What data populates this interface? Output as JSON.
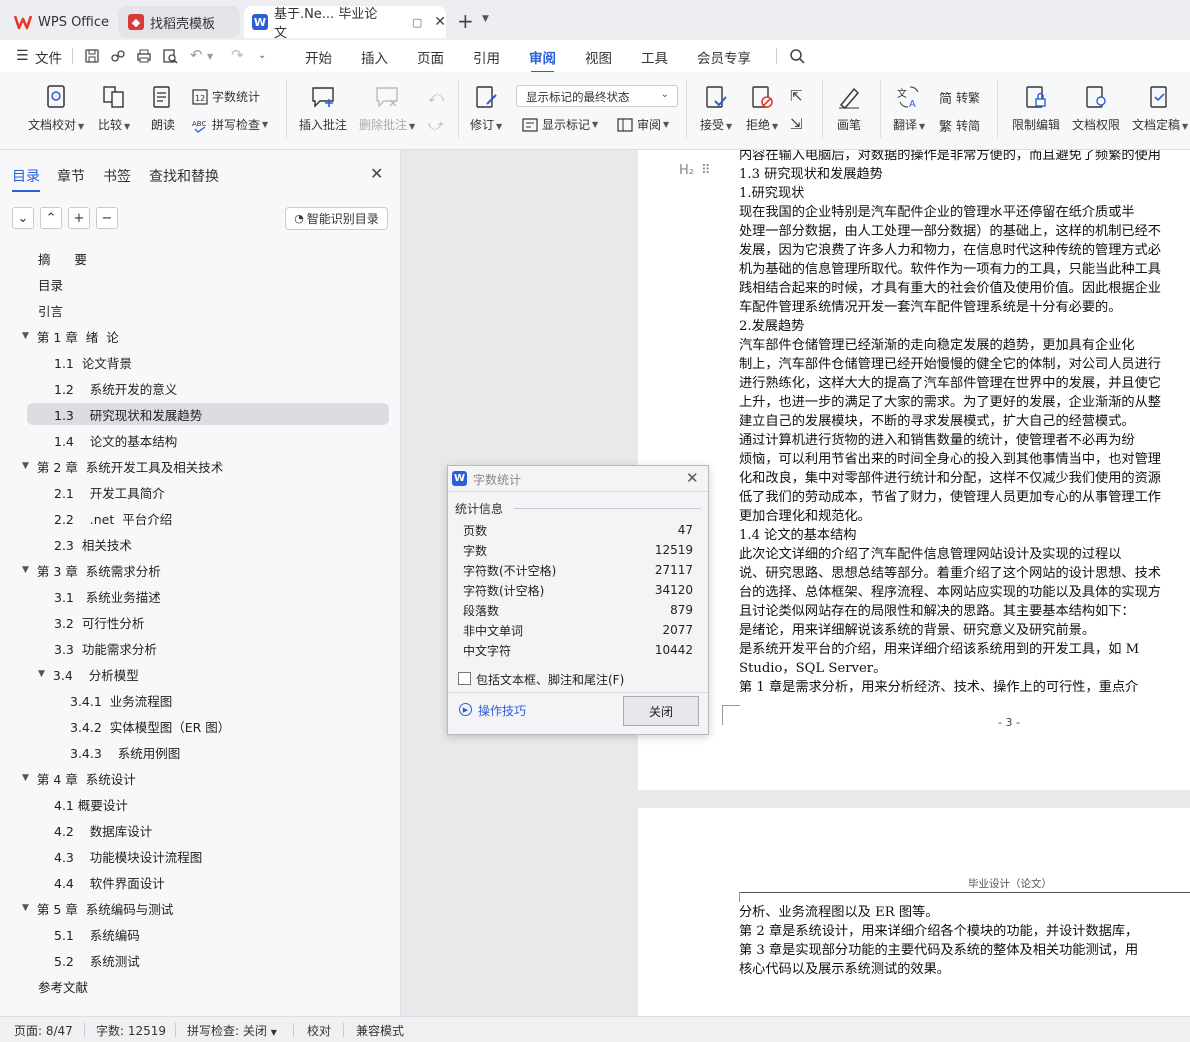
{
  "titlebar": {
    "tabs": [
      {
        "label": "WPS Office"
      },
      {
        "label": "找稻壳模板"
      },
      {
        "label": "基于.Ne... 毕业论文"
      }
    ],
    "new_tab": "+"
  },
  "menubar": {
    "file": "文件",
    "items": [
      "开始",
      "插入",
      "页面",
      "引用",
      "审阅",
      "视图",
      "工具",
      "会员专享"
    ],
    "active": "审阅"
  },
  "ribbon": {
    "doc_proof": "文档校对",
    "compare": "比较",
    "read_aloud": "朗读",
    "word_count": "字数统计",
    "spell_check": "拼写检查",
    "insert_comment": "插入批注",
    "delete_comment": "删除批注",
    "revise": "修订",
    "markup_state": "显示标记的最终状态",
    "show_markup": "显示标记",
    "review_pane": "审阅",
    "accept": "接受",
    "reject": "拒绝",
    "pen": "画笔",
    "translate": "翻译",
    "to_traditional": "转繁",
    "to_simplified": "转简",
    "restrict_edit": "限制编辑",
    "doc_permission": "文档权限",
    "doc_finalize": "文档定稿"
  },
  "nav": {
    "tabs": [
      "目录",
      "章节",
      "书签",
      "查找和替换"
    ],
    "smart_toc": "智能识别目录",
    "toc": [
      {
        "text": "摘      要",
        "level": 0,
        "tri": ""
      },
      {
        "text": "目录",
        "level": 0,
        "tri": ""
      },
      {
        "text": "引言",
        "level": 0,
        "tri": ""
      },
      {
        "text": "第 1 章  绪  论",
        "level": 0,
        "tri": "▼"
      },
      {
        "text": "1.1  论文背景",
        "level": 1,
        "tri": ""
      },
      {
        "text": "1.2    系统开发的意义",
        "level": 1,
        "tri": ""
      },
      {
        "text": "1.3    研究现状和发展趋势",
        "level": 1,
        "tri": "",
        "selected": true
      },
      {
        "text": "1.4    论文的基本结构",
        "level": 1,
        "tri": ""
      },
      {
        "text": "第 2 章  系统开发工具及相关技术",
        "level": 0,
        "tri": "▼"
      },
      {
        "text": "2.1    开发工具简介",
        "level": 1,
        "tri": ""
      },
      {
        "text": "2.2    .net  平台介绍",
        "level": 1,
        "tri": ""
      },
      {
        "text": "2.3  相关技术",
        "level": 1,
        "tri": ""
      },
      {
        "text": "第 3 章  系统需求分析",
        "level": 0,
        "tri": "▼"
      },
      {
        "text": "3.1   系统业务描述",
        "level": 1,
        "tri": ""
      },
      {
        "text": "3.2  可行性分析",
        "level": 1,
        "tri": ""
      },
      {
        "text": "3.3  功能需求分析",
        "level": 1,
        "tri": ""
      },
      {
        "text": "3.4    分析模型",
        "level": 1,
        "tri": "▼"
      },
      {
        "text": "3.4.1  业务流程图",
        "level": 2,
        "tri": ""
      },
      {
        "text": "3.4.2  实体模型图（ER 图）",
        "level": 2,
        "tri": ""
      },
      {
        "text": "3.4.3    系统用例图",
        "level": 2,
        "tri": ""
      },
      {
        "text": "第 4 章  系统设计",
        "level": 0,
        "tri": "▼"
      },
      {
        "text": "4.1 概要设计",
        "level": 1,
        "tri": ""
      },
      {
        "text": "4.2    数据库设计",
        "level": 1,
        "tri": ""
      },
      {
        "text": "4.3    功能模块设计流程图",
        "level": 1,
        "tri": ""
      },
      {
        "text": "4.4    软件界面设计",
        "level": 1,
        "tri": ""
      },
      {
        "text": "第 5 章  系统编码与测试",
        "level": 0,
        "tri": "▼"
      },
      {
        "text": "5.1    系统编码",
        "level": 1,
        "tri": ""
      },
      {
        "text": "5.2    系统测试",
        "level": 1,
        "tri": ""
      },
      {
        "text": "参考文献",
        "level": 0,
        "tri": ""
      }
    ]
  },
  "document": {
    "heading_marker": "H₂",
    "page1_lines": [
      "内容在输入电脑后，对数据的操作是非常方便的，而且避免了频繁的使用",
      "1.3    研究现状和发展趋势",
      "  1.研究现状",
      "    现在我国的企业特别是汽车配件企业的管理水平还停留在纸介质或半",
      "处理一部分数据，由人工处理一部分数据）的基础上，这样的机制已经不",
      "发展，因为它浪费了许多人力和物力，在信息时代这种传统的管理方式必",
      "机为基础的信息管理所取代。软件作为一项有力的工具，只能当此种工具",
      "践相结合起来的时候，才具有重大的社会价值及使用价值。因此根据企业",
      "车配件管理系统情况开发一套汽车配件管理系统是十分有必要的。",
      " 2.发展趋势",
      "      汽车部件仓储管理已经渐渐的走向稳定发展的趋势，更加具有企业化",
      "制上，汽车部件仓储管理已经开始慢慢的健全它的体制，对公司人员进行",
      "进行熟练化，这样大大的提高了汽车部件管理在世界中的发展，并且使它",
      "上升，也进一步的满足了大家的需求。为了更好的发展，企业渐渐的从整",
      "建立自己的发展模块，不断的寻求发展模式，扩大自己的经营模式。",
      "      通过计算机进行货物的进入和销售数量的统计，使管理者不必再为纷",
      "烦恼，可以利用节省出来的时间全身心的投入到其他事情当中，也对管理",
      "化和改良，集中对零部件进行统计和分配，这样不仅减少我们使用的资源",
      "低了我们的劳动成本，节省了财力，使管理人员更加专心的从事管理工作",
      "更加合理化和规范化。",
      "1.4    论文的基本结构",
      "      此次论文详细的介绍了汽车配件信息管理网站设计及实现的过程以",
      "说、研究思路、思想总结等部分。着重介绍了这个网站的设计思想、技术",
      "台的选择、总体框架、程序流程、本网站应实现的功能以及具体的实现方",
      "且讨论类似网站存在的局限性和解决的思路。其主要基本结构如下：",
      "是绪论，用来详细解说该系统的背景、研究意义及研究前景。",
      "是系统开发平台的介绍，用来详细介绍该系统用到的开发工具，如 M",
      "Studio，SQL Server。",
      "      第 1 章是需求分析，用来分析经济、技术、操作上的可行性，重点介"
    ],
    "page_number": "- 3 -",
    "page2_header": "毕业设计（论文）",
    "page2_lines": [
      "分析、业务流程图以及 ER 图等。",
      "      第 2 章是系统设计，用来详细介绍各个模块的功能，并设计数据库，",
      "      第 3 章是实现部分功能的主要代码及系统的整体及相关功能测试，用",
      "核心代码以及展示系统测试的效果。"
    ]
  },
  "dialog": {
    "title": "字数统计",
    "section": "统计信息",
    "rows": [
      {
        "label": "页数",
        "value": "47"
      },
      {
        "label": "字数",
        "value": "12519"
      },
      {
        "label": "字符数(不计空格)",
        "value": "27117"
      },
      {
        "label": "字符数(计空格)",
        "value": "34120"
      },
      {
        "label": "段落数",
        "value": "879"
      },
      {
        "label": "非中文单词",
        "value": "2077"
      },
      {
        "label": "中文字符",
        "value": "10442"
      }
    ],
    "checkbox_label": "包括文本框、脚注和尾注(F)",
    "tips": "操作技巧",
    "close_button": "关闭"
  },
  "status": {
    "page": "页面: 8/47",
    "words": "字数: 12519",
    "spell": "拼写检查: 关闭",
    "proof": "校对",
    "compat": "兼容模式"
  },
  "colors": {
    "accent": "#2b5fd8",
    "wps_red": "#e8382f",
    "docer_red": "#d83a3a"
  }
}
